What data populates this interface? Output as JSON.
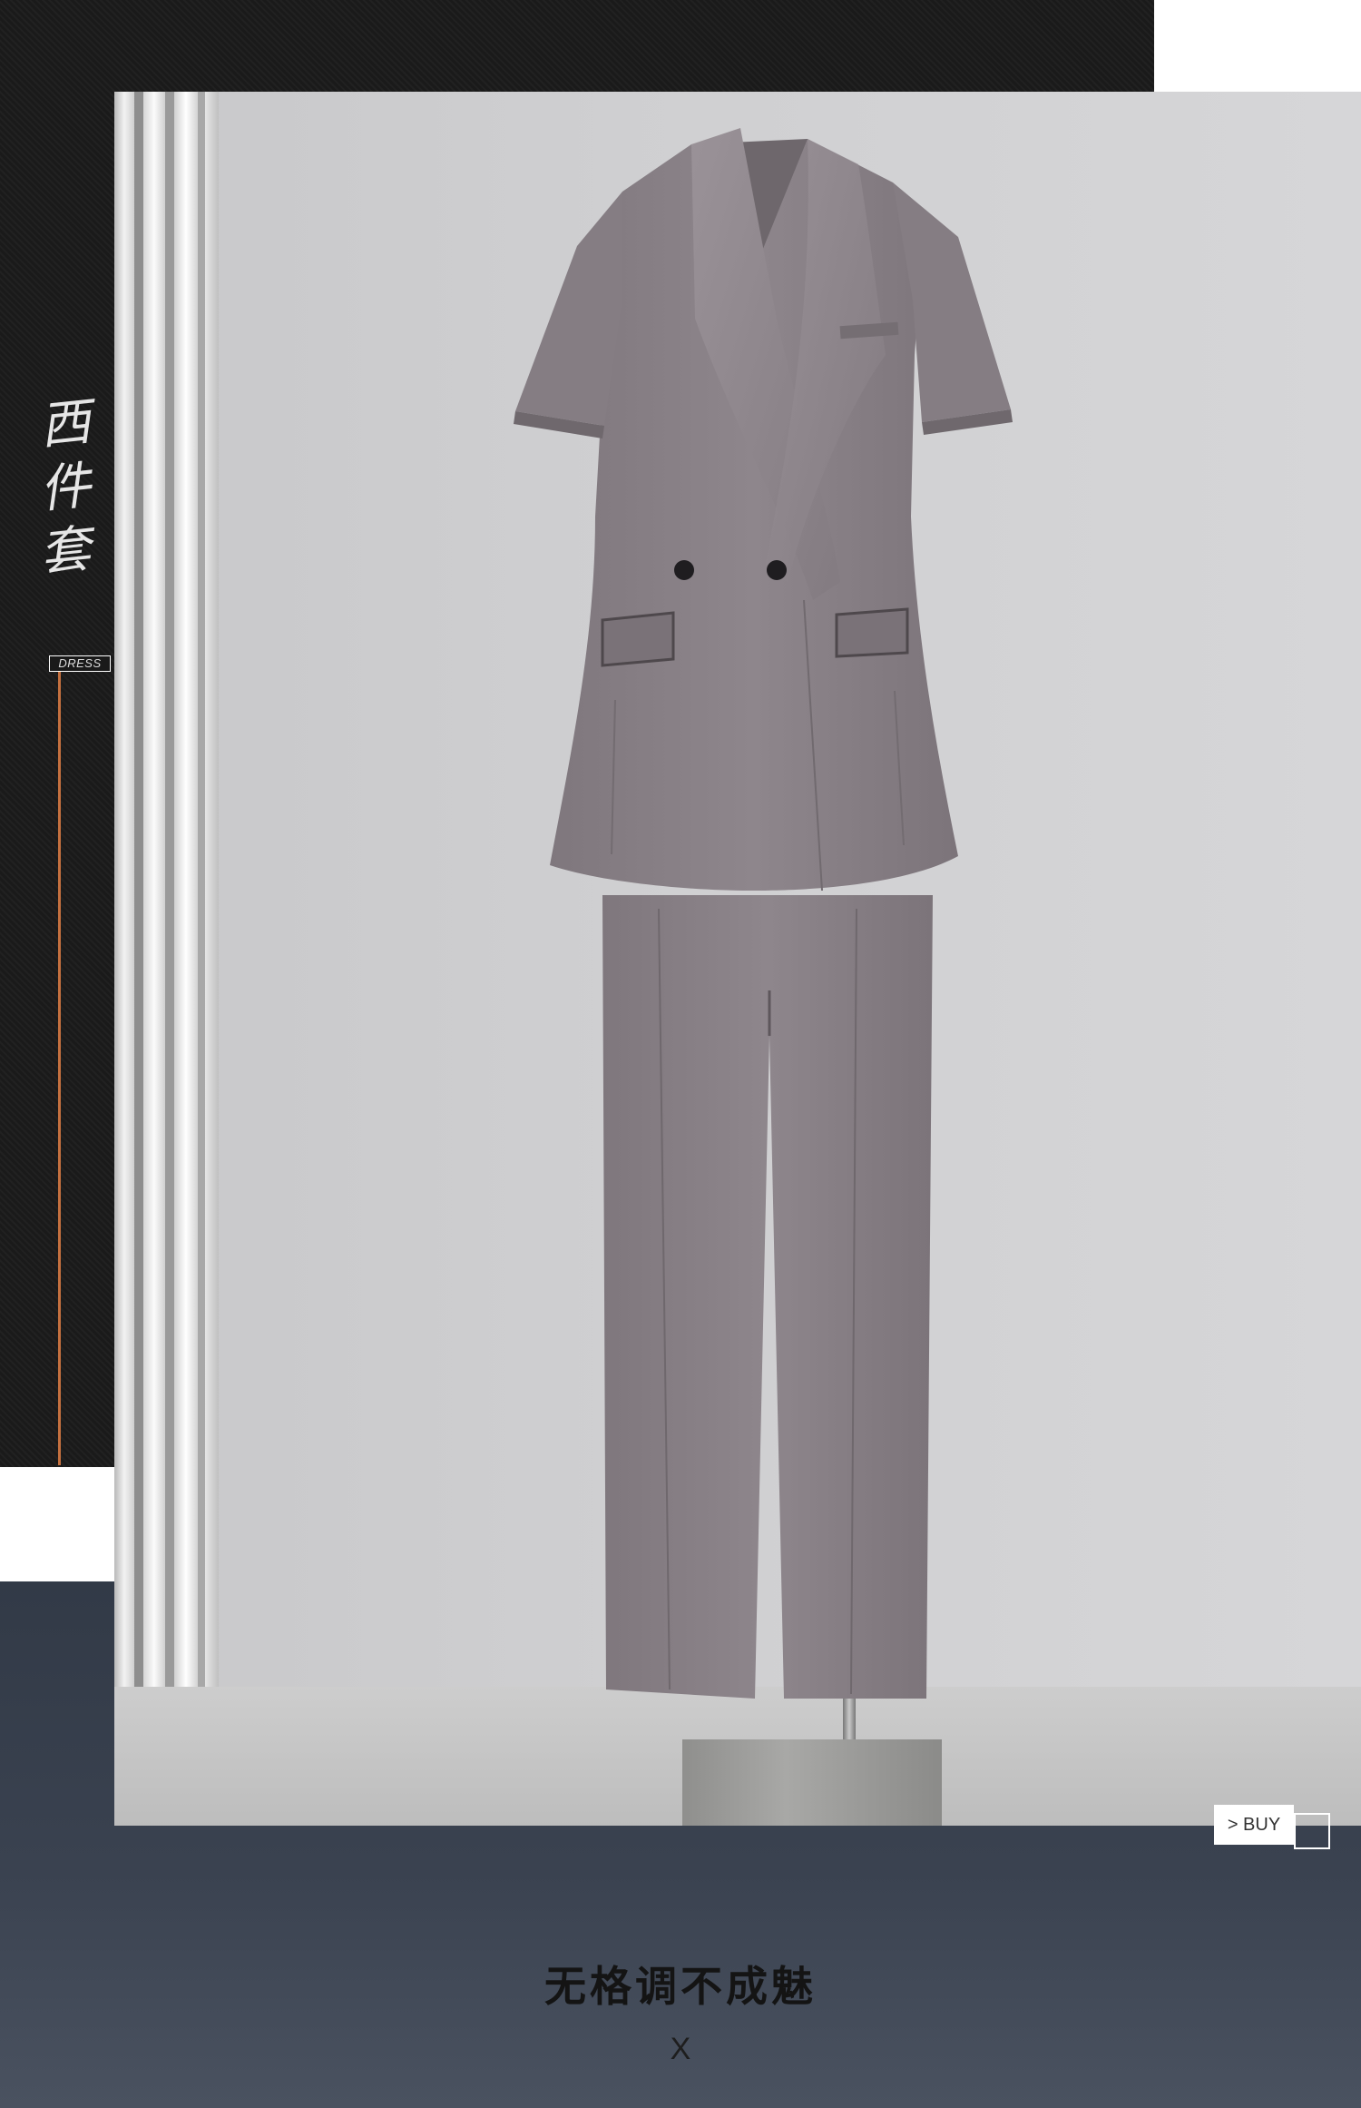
{
  "side_title": [
    "西",
    "件",
    "套"
  ],
  "dress_tag": "DRESS",
  "buy_button": {
    "label": "> BUY"
  },
  "slogan": "无格调不成魅",
  "divider_mark": "X",
  "colors": {
    "dark_panel": "#1a1a1a",
    "navy_band": "#353d4a",
    "accent_line": "#c4703f",
    "suit_fabric": "#8b8389"
  }
}
